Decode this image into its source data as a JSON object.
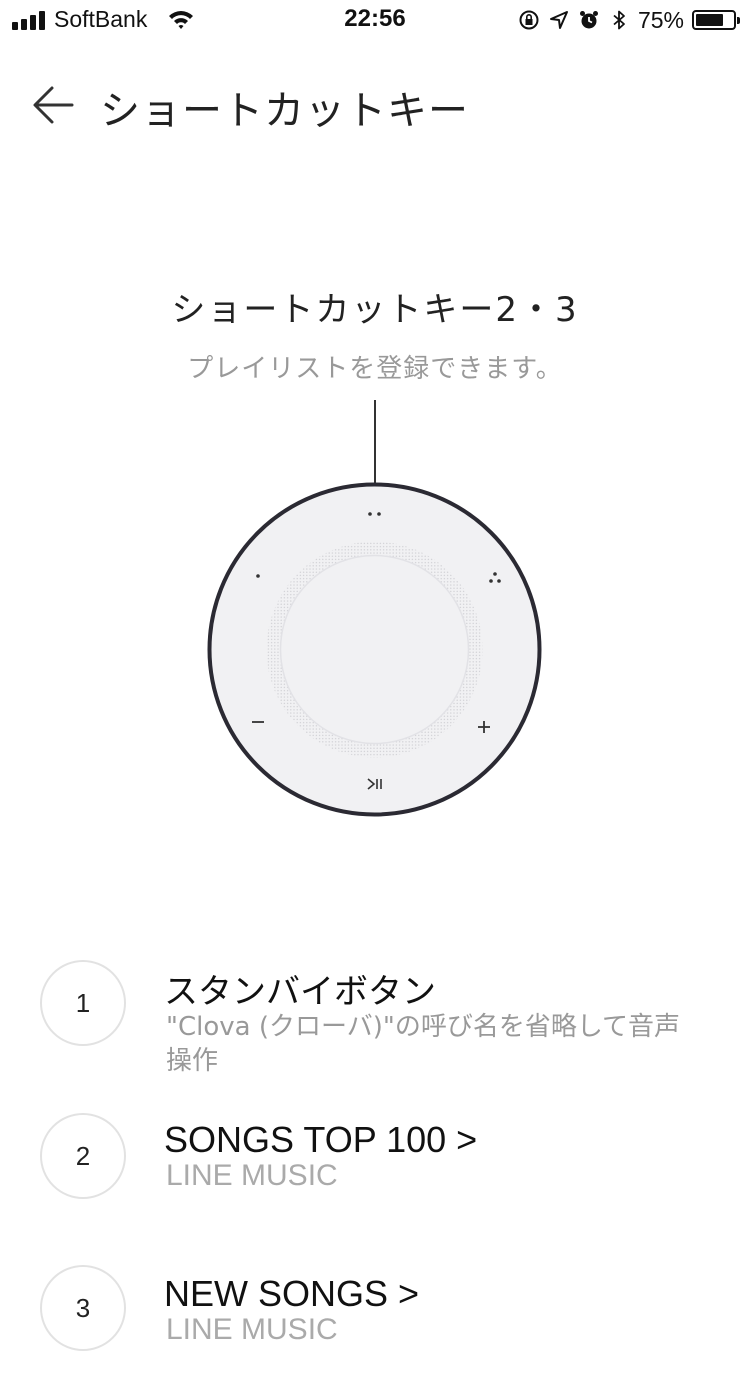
{
  "status_bar": {
    "carrier": "SoftBank",
    "time": "22:56",
    "battery": "75%",
    "battery_level": 0.75,
    "icons": [
      "signal-icon",
      "wifi-icon",
      "rotation-lock-icon",
      "location-icon",
      "alarm-icon",
      "bluetooth-icon",
      "battery-icon"
    ]
  },
  "header": {
    "title": "ショートカットキー",
    "back_icon": "back-arrow-icon"
  },
  "shortcut": {
    "title": "ショートカットキー2・3",
    "description": "プレイリストを登録できます。"
  },
  "device": {
    "buttons": [
      {
        "name": "shortcut-2-button",
        "glyph": "··"
      },
      {
        "name": "shortcut-1-button",
        "glyph": "·"
      },
      {
        "name": "shortcut-3-button",
        "glyph": "∴"
      },
      {
        "name": "volume-down-button",
        "glyph": "−"
      },
      {
        "name": "volume-up-button",
        "glyph": "+"
      },
      {
        "name": "play-pause-button",
        "glyph": "⏯"
      }
    ],
    "colors": {
      "ring": "#2b2a33",
      "face": "#f1f1f3"
    }
  },
  "list": [
    {
      "number": "1",
      "title": "スタンバイボタン",
      "subtitle": "\"Clova (クローバ)\"の呼び名を省略して音声操作"
    },
    {
      "number": "2",
      "title": "SONGS TOP 100 >",
      "subtitle": "LINE MUSIC"
    },
    {
      "number": "3",
      "title": "NEW SONGS >",
      "subtitle": "LINE MUSIC"
    }
  ]
}
